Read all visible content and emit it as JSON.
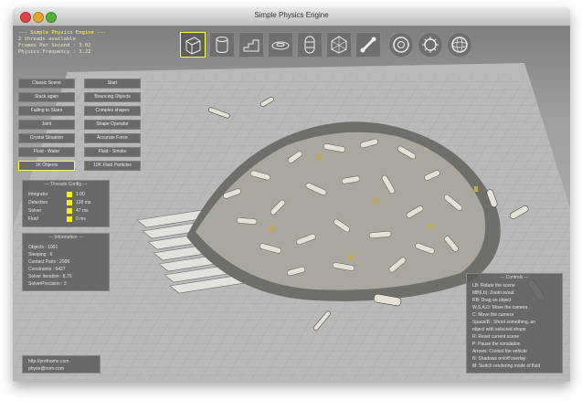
{
  "window": {
    "title": "Simple Physics Engine",
    "buttons": [
      "close",
      "minimize",
      "zoom"
    ]
  },
  "stats": {
    "header": "--- Simple Physics Engine ---",
    "lines": [
      "2 threads available",
      "Frames Per Second : 3.02",
      "Physics Frequency : 3.22"
    ]
  },
  "toolbar": {
    "tools": [
      {
        "icon": "box-icon",
        "selected": true
      },
      {
        "icon": "cylinder-icon",
        "selected": false
      },
      {
        "icon": "stairs-icon",
        "selected": false
      },
      {
        "icon": "torus-icon",
        "selected": false
      },
      {
        "icon": "capsule-icon",
        "selected": false
      },
      {
        "icon": "polyhedron-icon",
        "selected": false
      },
      {
        "icon": "bone-icon",
        "selected": false
      },
      {
        "icon": "ring-icon",
        "selected": false
      },
      {
        "icon": "gear-icon",
        "selected": false
      },
      {
        "icon": "sphere-icon",
        "selected": false
      }
    ]
  },
  "scene_buttons": [
    {
      "label": "Classic Scene",
      "selected": false
    },
    {
      "label": "Start",
      "selected": false
    },
    {
      "label": "Stack again",
      "selected": false
    },
    {
      "label": "Bouncing Objects",
      "selected": false
    },
    {
      "label": "Falling to Stairs",
      "selected": false
    },
    {
      "label": "Complex shapes",
      "selected": false
    },
    {
      "label": "Joint",
      "selected": false
    },
    {
      "label": "Shape Operator",
      "selected": false
    },
    {
      "label": "Crystal Situation",
      "selected": false
    },
    {
      "label": "Accurate Force",
      "selected": false
    },
    {
      "label": "Fluid - Water",
      "selected": false
    },
    {
      "label": "Fluid - Smoke",
      "selected": false
    },
    {
      "label": "1K Objects",
      "selected": true
    },
    {
      "label": "10K Fluid Particles",
      "selected": false
    }
  ],
  "threads_panel": {
    "title": "--- Threads Config ---",
    "rows": [
      {
        "label": "Integrator",
        "value": "1.00"
      },
      {
        "label": "Detection",
        "value": "128 ms"
      },
      {
        "label": "Solver",
        "value": "47 ms"
      },
      {
        "label": "Fluid",
        "value": "0 ms"
      }
    ]
  },
  "info_panel": {
    "title": "--- Information ---",
    "lines": [
      "Objects : 1001",
      "Sleeping : 6",
      "Contact Pairs : 2996",
      "Constraints : 6427",
      "Solver Iteration : 8.75",
      "SolverPrecision : 3"
    ]
  },
  "footer": {
    "lines": [
      "http://prefname.com",
      "physe@nom.com"
    ]
  },
  "controls_panel": {
    "title": "--- Controls ---",
    "lines": [
      "LB: Rotate the scene",
      "MB(Lb): Zoom in/out",
      "RB: Drag an object",
      "W,S,A,D: Move the camera",
      "C: Move the camera",
      "Space/B : Shoot something, an",
      "      object with selected shape",
      "R: Reset current scene",
      "P: Pause the simulation",
      "Arrows: Control the vehicle",
      "N: Shadows on/off overlay",
      "M: Switch rendering mode of fluid"
    ]
  },
  "colors": {
    "accent": "#ffff44",
    "panel_bg": "#5a5a5a",
    "floor": "#b8b8b8",
    "object": "#d9d6cc",
    "object_band": "#c8a840"
  }
}
